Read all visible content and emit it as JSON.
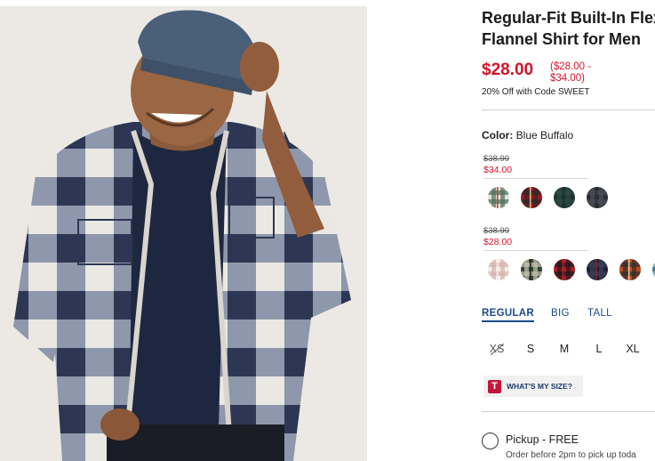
{
  "product": {
    "title_line1": "Regular-Fit Built-In Flex",
    "title_line2": "Flannel Shirt for Men",
    "price": "$28.00",
    "price_range_line1": "($28.00 -",
    "price_range_line2": "$34.00)",
    "promo": "20% Off with Code SWEET"
  },
  "color": {
    "label": "Color:",
    "value": "Blue Buffalo",
    "groups": [
      {
        "was": "$38.99",
        "now": "$34.00",
        "swatches": [
          {
            "name": "swatch-cream-plaid",
            "base": "#e8e3da",
            "stripe": "#4a6f5a",
            "accent": "#c0392b"
          },
          {
            "name": "swatch-red-plaid",
            "base": "#a3141f",
            "stripe": "#2b2b2b",
            "accent": "#d9c08a"
          },
          {
            "name": "swatch-dark-green",
            "base": "#1e3330",
            "stripe": "#2c4a45",
            "accent": "#1e3330"
          },
          {
            "name": "swatch-charcoal-check",
            "base": "#2a2d33",
            "stripe": "#4b4f57",
            "accent": "#2a2d33"
          }
        ]
      },
      {
        "was": "$38.99",
        "now": "$28.00",
        "swatches": [
          {
            "name": "swatch-white-red-stripe",
            "base": "#f2efea",
            "stripe": "#d6b2ad",
            "accent": "#f2efea"
          },
          {
            "name": "swatch-green-tan-plaid",
            "base": "#2f4536",
            "stripe": "#c9c2ae",
            "accent": "#1f2a22"
          },
          {
            "name": "swatch-red-black-buffalo",
            "base": "#b01b24",
            "stripe": "#1c1c1c",
            "accent": "#b01b24"
          },
          {
            "name": "swatch-navy-red-plaid",
            "base": "#1b2233",
            "stripe": "#3a3f55",
            "accent": "#9b2230"
          },
          {
            "name": "swatch-orange-plaid",
            "base": "#c4481e",
            "stripe": "#2f2f2f",
            "accent": "#e0c9a6"
          },
          {
            "name": "swatch-teal-plaid",
            "base": "#4b7f87",
            "stripe": "#9cc0c4",
            "accent": "#2a4f55"
          }
        ]
      }
    ]
  },
  "fits": [
    "REGULAR",
    "BIG",
    "TALL"
  ],
  "sizes": [
    "XS",
    "S",
    "M",
    "L",
    "XL"
  ],
  "whats_my_size": {
    "badge": "T",
    "label": "WHAT'S MY SIZE?"
  },
  "pickup": {
    "label": "Pickup - FREE",
    "note": "Order before 2pm to pick up toda"
  },
  "colors": {
    "sale_red": "#d3132a",
    "link_blue": "#1c4a8a"
  }
}
